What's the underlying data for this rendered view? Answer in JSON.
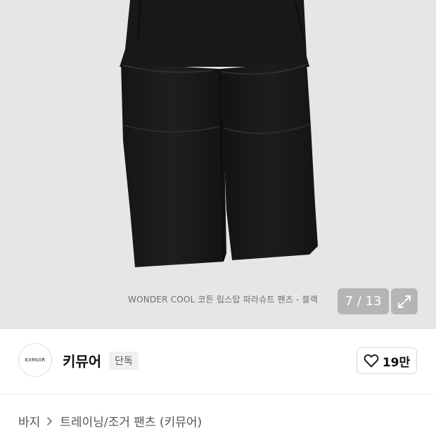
{
  "gallery": {
    "caption": "WONDER COOL 코튼 립스탑 파라슈트 팬츠 - 블랙",
    "counter": "7 / 13",
    "current": 7,
    "total": 13,
    "background": "#e6e6e6",
    "expand_icon": "expand-arrows-icon"
  },
  "brand": {
    "logo_text": "KIIMUIR",
    "name": "키뮤어",
    "badge": "단독"
  },
  "like": {
    "icon": "heart-outline-icon",
    "count": "19만"
  },
  "breadcrumb": {
    "first": "바지",
    "separator_icon": "chevron-right-icon",
    "second": "트레이닝/조거 팬츠 (키뮤어)"
  }
}
